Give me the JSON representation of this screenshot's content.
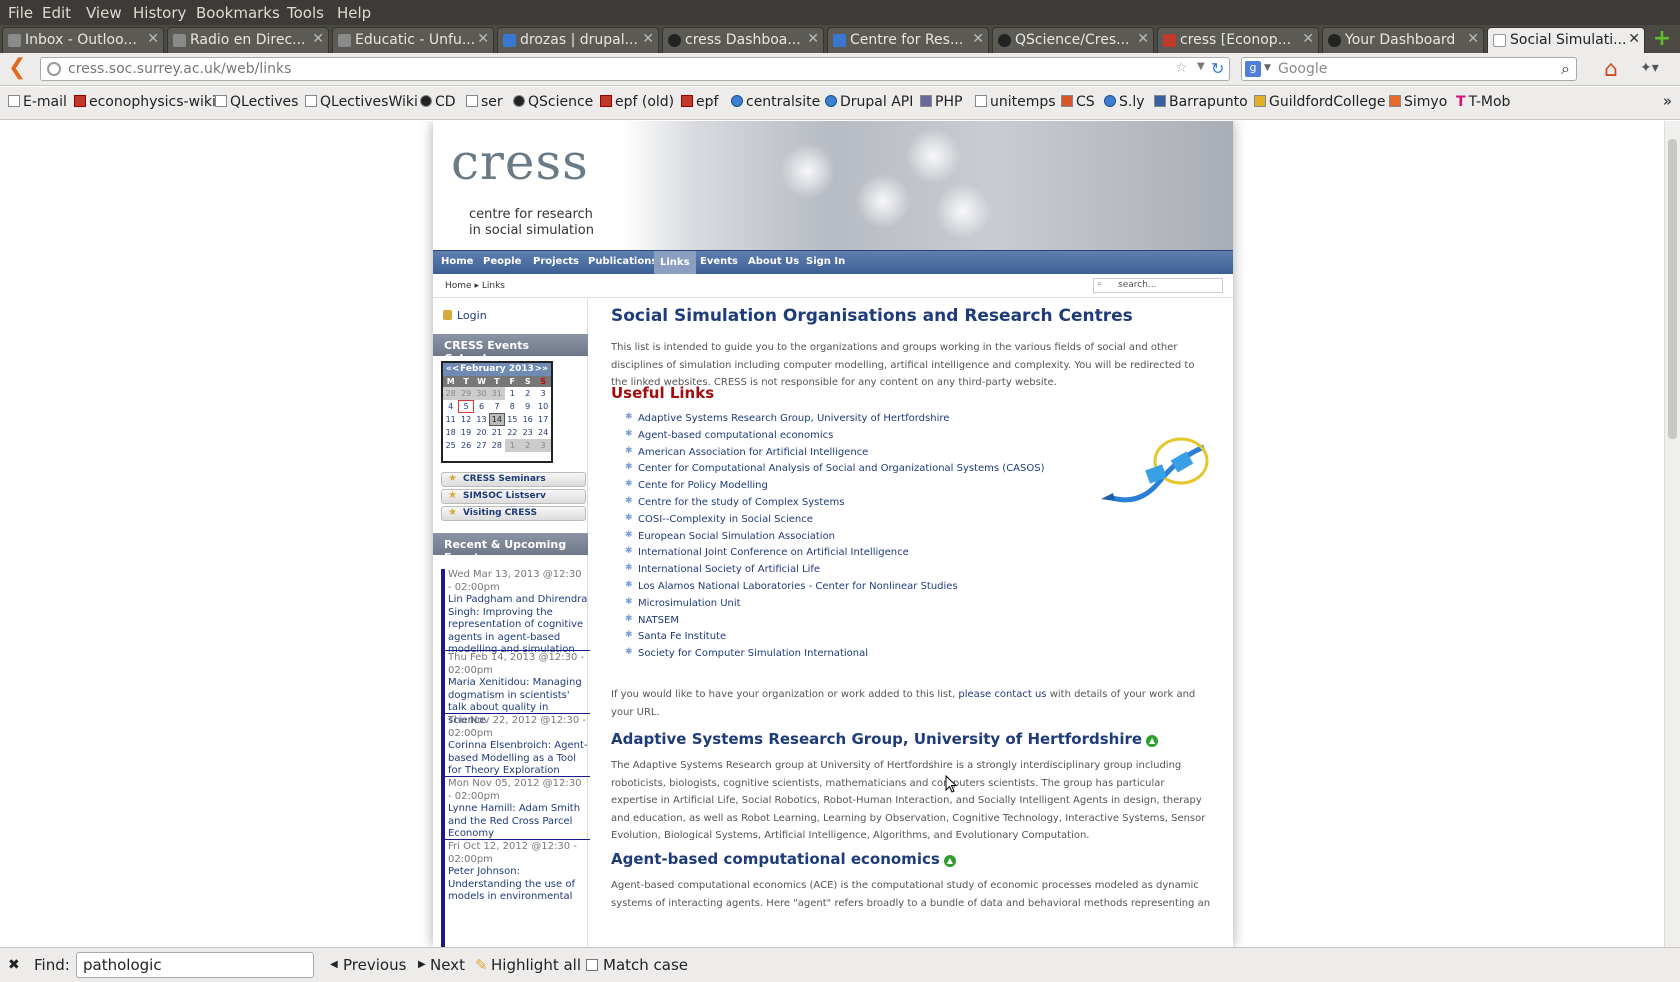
{
  "menubar": {
    "items": [
      "File",
      "Edit",
      "View",
      "History",
      "Bookmarks",
      "Tools",
      "Help"
    ]
  },
  "tabs": [
    {
      "label": "Inbox - Outloo..."
    },
    {
      "label": "Radio en Direc..."
    },
    {
      "label": "Educatic - Unfu..."
    },
    {
      "label": "drozas | drupal..."
    },
    {
      "label": "cress Dashboa..."
    },
    {
      "label": "Centre for Res..."
    },
    {
      "label": "QScience/Cres..."
    },
    {
      "label": "cress [Econop..."
    },
    {
      "label": "Your Dashboard"
    },
    {
      "label": "Social Simulati..."
    }
  ],
  "addressbar": {
    "url": "cress.soc.surrey.ac.uk/web/links"
  },
  "searchbar": {
    "placeholder": "Google",
    "engine_icon": "g-icon"
  },
  "bookmarks": [
    "E-mail",
    "econophysics-wiki",
    "QLectives",
    "QLectivesWiki",
    "CD",
    "ser",
    "QScience",
    "epf (old)",
    "epf",
    "centralsite",
    "Drupal API",
    "PHP",
    "unitemps",
    "CS",
    "S.ly",
    "Barrapunto",
    "GuildfordCollege",
    "Simyo",
    "T-Mob"
  ],
  "site": {
    "logo": "cress",
    "tagline_1": "centre for research",
    "tagline_2": "in social simulation",
    "nav": [
      "Home",
      "People",
      "Projects",
      "Publications",
      "Links",
      "Events",
      "About Us",
      "Sign In"
    ],
    "breadcrumb": {
      "home": "Home",
      "current": "Links"
    },
    "search_placeholder": "search..."
  },
  "sidebar": {
    "login": "Login",
    "calendar_title": "CRESS Events Calendar",
    "calendar": {
      "month": "February 2013",
      "prev": "«<",
      "next": ">»",
      "dow": [
        "M",
        "T",
        "W",
        "T",
        "F",
        "S",
        "S"
      ],
      "weeks": [
        [
          "28",
          "29",
          "30",
          "31",
          "1",
          "2",
          "3"
        ],
        [
          "4",
          "5",
          "6",
          "7",
          "8",
          "9",
          "10"
        ],
        [
          "11",
          "12",
          "13",
          "14",
          "15",
          "16",
          "17"
        ],
        [
          "18",
          "19",
          "20",
          "21",
          "22",
          "23",
          "24"
        ],
        [
          "25",
          "26",
          "27",
          "28",
          "1",
          "2",
          "3"
        ]
      ]
    },
    "buttons": [
      "CRESS Seminars",
      "SIMSOC Listserv",
      "Visiting CRESS"
    ],
    "events_title": "Recent & Upcoming Events",
    "events": [
      {
        "when": "Wed Mar 13, 2013 @12:30 - 02:00pm",
        "what": "Lin Padgham and Dhirendra Singh: Improving the representation of cognitive agents in agent-based modelling and simulation"
      },
      {
        "when": "Thu Feb 14, 2013 @12:30 - 02:00pm",
        "what": "Maria Xenitidou: Managing dogmatism in scientists' talk about quality in science"
      },
      {
        "when": "Thu Nov 22, 2012 @12:30 - 02:00pm",
        "what": "Corinna Elsenbroich: Agent-based Modelling as a Tool for Theory Exploration"
      },
      {
        "when": "Mon Nov 05, 2012 @12:30 - 02:00pm",
        "what": "Lynne Hamill: Adam Smith and the Red Cross Parcel Economy"
      },
      {
        "when": "Fri Oct 12, 2012 @12:30 - 02:00pm",
        "what": "Peter Johnson: Understanding the use of models in environmental"
      }
    ]
  },
  "content": {
    "title": "Social Simulation Organisations and Research Centres",
    "intro": "This list is intended to guide you to the organizations and groups working in the various fields of social and other disciplines of simulation including computer modelling, artifical intelligence and complexity. You will be redirected to the linked websites. CRESS is not responsible for any content on any third-party website.",
    "useful_title": "Useful Links",
    "links": [
      "Adaptive Systems Research Group, University of Hertfordshire",
      "Agent-based computational economics",
      "American Association for Artificial Intelligence",
      "Center for Computational Analysis of Social and Organizational Systems (CASOS)",
      "Cente for Policy Modelling",
      "Centre for the study of Complex Systems",
      "COSI--Complexity in Social Science",
      "European Social Simulation Association",
      "International Joint Conference on Artificial Intelligence",
      "International Society of Artificial Life",
      "Los Alamos National Laboratories - Center for Nonlinear Studies",
      "Microsimulation Unit",
      "NATSEM",
      "Santa Fe Institute",
      "Society for Computer Simulation International"
    ],
    "contact_before": "If you would like to have your organization or work added to this list, ",
    "contact_link": "please contact us",
    "contact_after": " with details of your work and your URL.",
    "sec1_title": "Adaptive Systems Research Group, University of Hertfordshire",
    "sec1_text": "The Adaptive Systems Research group at University of Hertfordshire is a strongly interdisciplinary group including roboticists, biologists, cognitive scientists, mathematicians and computers scientists. The group has particular expertise in Artificial Life, Social Robotics, Robot-Human Interaction, and Socially Intelligent Agents in design, therapy and education, as well as Robot Learning, Learning by Observation, Cognitive Technology, Interactive Systems, Sensor Evolution, Biological Systems, Artificial Intelligence, Algorithms, and Evolutionary Computation.",
    "sec2_title": "Agent-based computational economics",
    "sec2_text": "Agent-based computational economics (ACE) is the computational study of economic processes modeled as dynamic systems of interacting agents. Here \"agent\" refers broadly to a bundle of data and behavioral methods representing an"
  },
  "findbar": {
    "label": "Find:",
    "value": "pathologic",
    "previous": "Previous",
    "next": "Next",
    "highlight": "Highlight all",
    "match_case": "Match case"
  }
}
